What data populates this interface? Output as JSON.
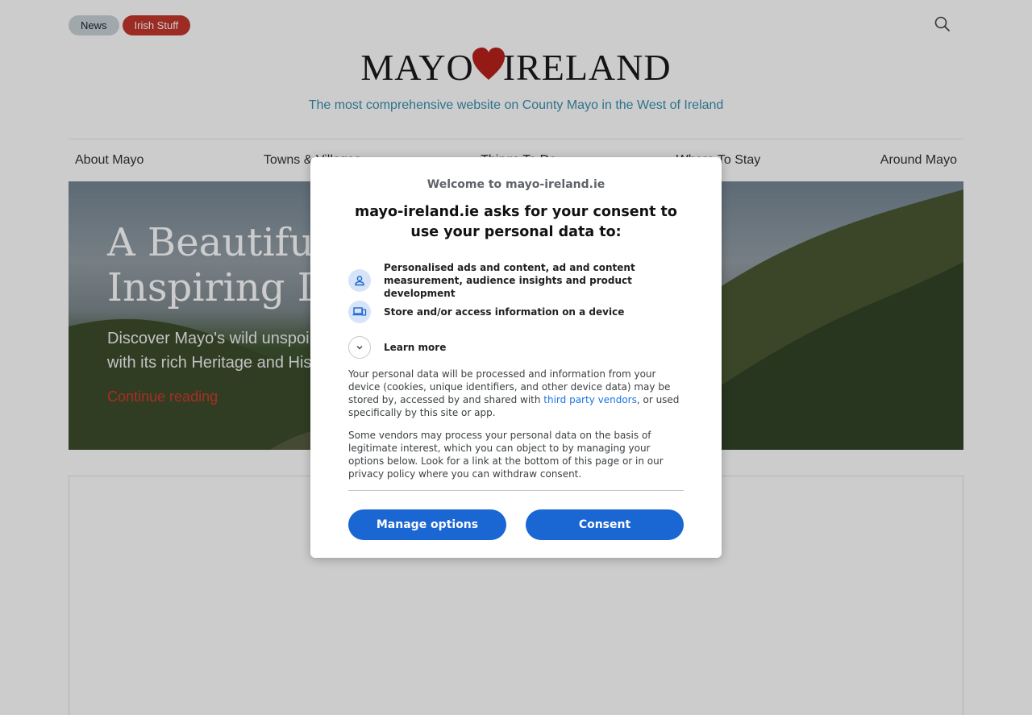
{
  "header": {
    "tags": [
      "News",
      "Irish Stuff"
    ],
    "logo_left": "MAYO",
    "logo_right": "IRELAND",
    "tagline": "The most comprehensive website on County Mayo in the West of Ireland",
    "search_icon": "search-icon"
  },
  "nav": {
    "items": [
      "About Mayo",
      "Towns & Villages",
      "Things To Do",
      "Where To Stay",
      "Around Mayo"
    ]
  },
  "hero": {
    "title": "A Beautiful\nInspiring De",
    "text": "Discover Mayo's wild unspoi\nwith its rich Heritage and His",
    "link": "Continue reading"
  },
  "consent": {
    "welcome": "Welcome to mayo-ireland.ie",
    "heading": "mayo-ireland.ie asks for your consent to use your personal data to:",
    "purposes": [
      {
        "icon": "person-icon",
        "label": "Personalised ads and content, ad and content measurement, audience insights and product development"
      },
      {
        "icon": "devices-icon",
        "label": "Store and/or access information on a device"
      }
    ],
    "learn_more": "Learn more",
    "para1_before": "Your personal data will be processed and information from your device (cookies, unique identifiers, and other device data) may be stored by, accessed by and shared with ",
    "para1_link": "third party vendors",
    "para1_after": ", or used specifically by this site or app.",
    "para2": "Some vendors may process your personal data on the basis of legitimate interest, which you can object to by managing your options below. Look for a link at the bottom of this page or in our privacy policy where you can withdraw consent.",
    "manage_label": "Manage options",
    "consent_label": "Consent"
  },
  "colors": {
    "accent_red": "#c4362c",
    "tagline_blue": "#3a8fb0",
    "button_blue": "#1a66d2",
    "link_blue": "#1a73e8"
  }
}
